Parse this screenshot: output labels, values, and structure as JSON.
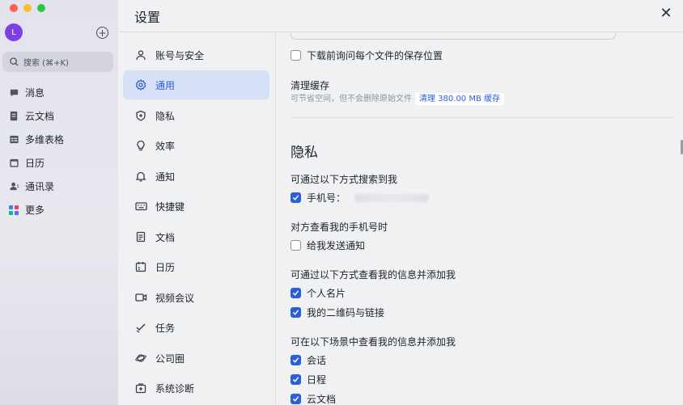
{
  "app": {
    "avatar_letter": "L",
    "search_placeholder": "搜索 (⌘+K)",
    "nav": [
      {
        "label": "消息",
        "icon": "message-icon"
      },
      {
        "label": "云文档",
        "icon": "cloud-doc-icon"
      },
      {
        "label": "多维表格",
        "icon": "base-table-icon"
      },
      {
        "label": "日历",
        "icon": "calendar-icon"
      },
      {
        "label": "通讯录",
        "icon": "contacts-icon"
      },
      {
        "label": "更多",
        "icon": "more-apps-icon"
      }
    ]
  },
  "settings": {
    "title": "设置",
    "categories": [
      {
        "label": "账号与安全",
        "icon": "person-icon"
      },
      {
        "label": "通用",
        "icon": "gear-icon",
        "active": true
      },
      {
        "label": "隐私",
        "icon": "shield-icon"
      },
      {
        "label": "效率",
        "icon": "lightbulb-icon"
      },
      {
        "label": "通知",
        "icon": "bell-icon"
      },
      {
        "label": "快捷键",
        "icon": "keyboard-icon"
      },
      {
        "label": "文档",
        "icon": "document-icon"
      },
      {
        "label": "日历",
        "icon": "calendar-icon"
      },
      {
        "label": "视频会议",
        "icon": "video-icon"
      },
      {
        "label": "任务",
        "icon": "task-check-icon"
      },
      {
        "label": "公司圈",
        "icon": "planet-icon"
      },
      {
        "label": "系统诊断",
        "icon": "medkit-icon"
      }
    ],
    "general": {
      "ask_save_location_label": "下载前询问每个文件的保存位置",
      "ask_save_location_checked": false,
      "clear_cache_title": "清理缓存",
      "clear_cache_hint": "可节省空间，但不会删除原始文件",
      "clear_cache_link": "清理 380.00 MB 缓存"
    },
    "privacy": {
      "section_title": "隐私",
      "search_me_title": "可通过以下方式搜索到我",
      "search_by_phone_label": "手机号：",
      "search_by_phone_checked": true,
      "view_phone_title": "对方查看我的手机号时",
      "notify_me_label": "给我发送通知",
      "notify_me_checked": false,
      "add_me_title": "可通过以下方式查看我的信息并添加我",
      "add_options": [
        {
          "label": "个人名片",
          "checked": true
        },
        {
          "label": "我的二维码与链接",
          "checked": true
        }
      ],
      "scenes_title": "可在以下场景中查看我的信息并添加我",
      "scenes": [
        {
          "label": "会话",
          "checked": true
        },
        {
          "label": "日程",
          "checked": true
        },
        {
          "label": "云文档",
          "checked": true
        }
      ]
    }
  }
}
